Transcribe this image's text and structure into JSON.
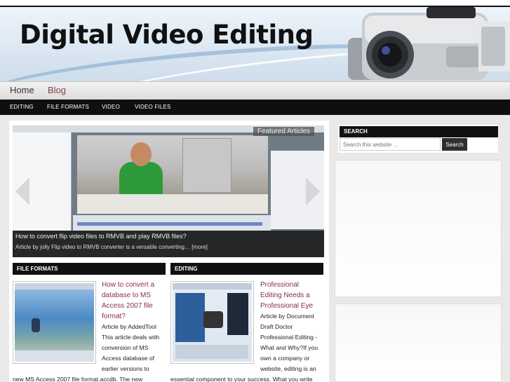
{
  "site": {
    "title": "Digital Video Editing"
  },
  "nav_primary": [
    {
      "label": "Home"
    },
    {
      "label": "Blog"
    }
  ],
  "nav_secondary": [
    {
      "label": "EDITING"
    },
    {
      "label": "FILE FORMATS"
    },
    {
      "label": "VIDEO"
    },
    {
      "label": "VIDEO FILES"
    }
  ],
  "slider": {
    "badge": "Featured Articles",
    "caption_title": "How to convert flip video files to RMVB and play RMVB files?",
    "caption_excerpt": "Article by jolly Flip video to RMVB converter is a versatile converting… [more]"
  },
  "sections": [
    {
      "heading": "FILE FORMATS",
      "post_title_lines": [
        "How to convert a",
        "database to MS",
        "Access 2007 file",
        "format?"
      ],
      "post_lines": [
        "Article by AddedTool",
        "This article deals with",
        "conversion of MS",
        "Access database of",
        "earlier versions to",
        "new MS Access 2007 file format.accdb. The new"
      ]
    },
    {
      "heading": "EDITING",
      "post_title_lines": [
        "Professional",
        "Editing Needs a",
        "Professional Eye"
      ],
      "post_lines": [
        "Article by Document",
        "Draft Doctor",
        "Professional Editing -",
        "What and Why?If you",
        "own a company or",
        "website, editing is an",
        "essential component to your success. What you write"
      ]
    }
  ],
  "sidebar": {
    "search_heading": "SEARCH",
    "search_placeholder": "Search this website ...",
    "search_button": "Search"
  }
}
